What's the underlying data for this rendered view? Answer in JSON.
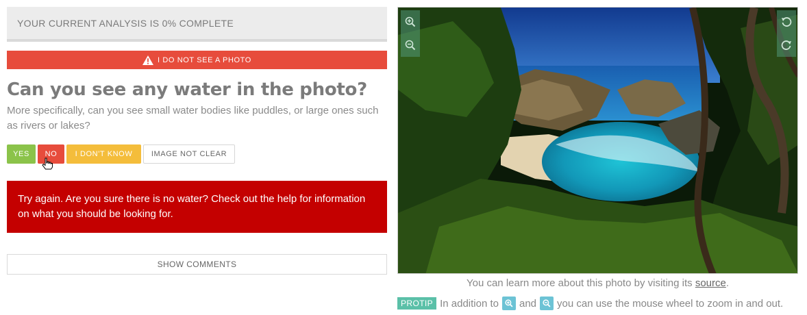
{
  "progress": {
    "text": "YOUR CURRENT ANALYSIS IS 0% COMPLETE",
    "percent": 0
  },
  "no_photo_button": {
    "label": "I DO NOT SEE A PHOTO",
    "icon": "warning-icon"
  },
  "question": {
    "title": "Can you see any water in the photo?",
    "subtitle": "More specifically, can you see small water bodies like puddles, or large ones such as rivers or lakes?"
  },
  "answers": {
    "yes": "YES",
    "no": "NO",
    "dont_know": "I DON'T KNOW",
    "not_clear": "IMAGE NOT CLEAR"
  },
  "alert": {
    "text": "Try again. Are you sure there is no water? Check out the help for information on what you should be looking for."
  },
  "comments_button": {
    "label": "SHOW COMMENTS"
  },
  "photo_controls": {
    "zoom_in": "zoom-in-icon",
    "zoom_out": "zoom-out-icon",
    "rotate_left": "rotate-left-icon",
    "rotate_right": "rotate-right-icon"
  },
  "caption": {
    "prefix": "You can learn more about this photo by visiting its",
    "link": "source",
    "suffix": "."
  },
  "protip": {
    "badge": "PROTIP",
    "text1": "In addition to",
    "text2": "and",
    "text3": "you can use the mouse wheel to zoom in and out."
  },
  "colors": {
    "danger": "#e74c3c",
    "alert": "#c40000",
    "success": "#8bc34a",
    "warning": "#f4bd3b",
    "protip": "#5bc0a8",
    "info": "#6cc3d5"
  }
}
